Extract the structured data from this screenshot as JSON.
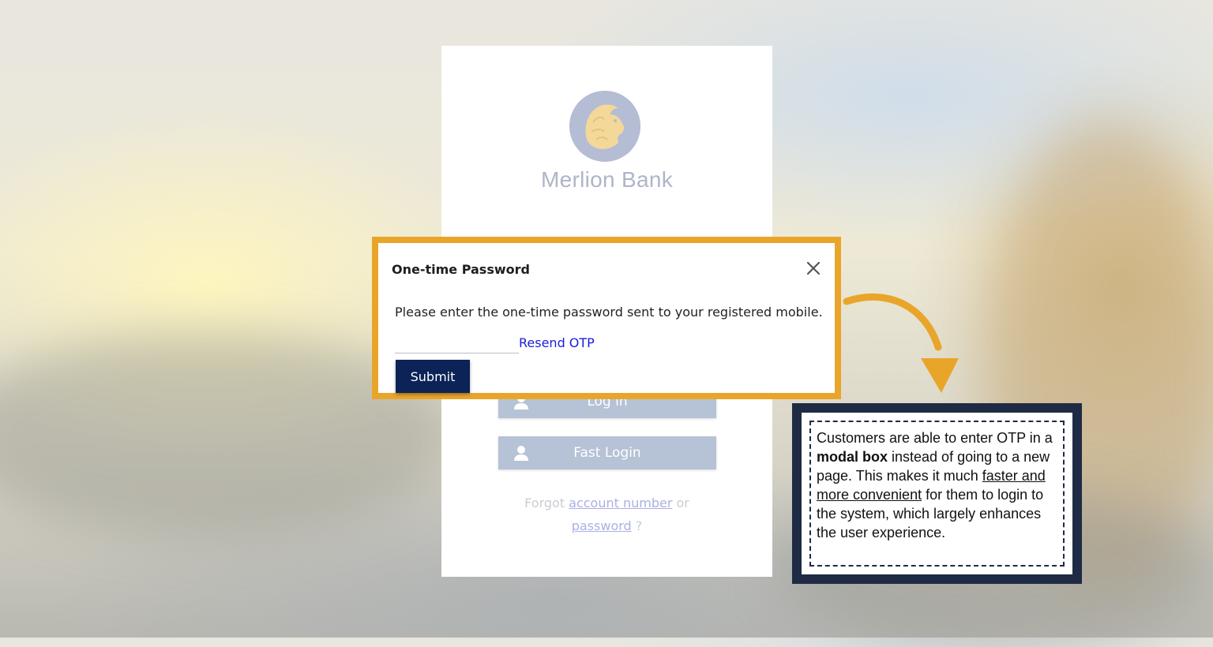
{
  "brand": {
    "name": "Merlion Bank",
    "logo_icon": "lion-icon"
  },
  "login": {
    "login_label": "Log in",
    "fast_login_label": "Fast Login",
    "forgot_prefix": "Forgot",
    "account_number_link": "account number",
    "or_text": "or",
    "password_link": "password",
    "suffix": "?"
  },
  "modal": {
    "title": "One-time Password",
    "message": "Please enter the one-time password sent to your registered mobile.",
    "otp_value": "",
    "resend_label": "Resend OTP",
    "submit_label": "Submit"
  },
  "annotation": {
    "part1": "Customers are able to enter OTP in a ",
    "bold": "modal box",
    "part2": " instead of going to a new page. This makes it much ",
    "underlined": "faster and more convenient",
    "part3": " for them to login to the system, which largely enhances the user experience."
  },
  "colors": {
    "modal_border": "#e9a52a",
    "submit_bg": "#0b2356",
    "link": "#1b1be0",
    "note_frame": "#1f2b45",
    "disabled_button": "#b6c2d5"
  }
}
